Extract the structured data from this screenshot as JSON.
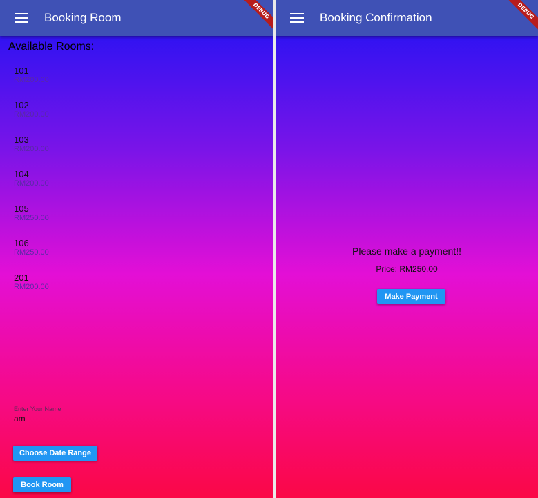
{
  "left": {
    "appbar": {
      "title": "Booking Room"
    },
    "debug_label": "DEBUG",
    "rooms_heading": "Available Rooms:",
    "rooms": [
      {
        "number": "101",
        "price": "RM200.00"
      },
      {
        "number": "102",
        "price": "RM200.00"
      },
      {
        "number": "103",
        "price": "RM200.00"
      },
      {
        "number": "104",
        "price": "RM200.00"
      },
      {
        "number": "105",
        "price": "RM250.00"
      },
      {
        "number": "106",
        "price": "RM250.00"
      },
      {
        "number": "201",
        "price": "RM200.00"
      }
    ],
    "name_field": {
      "label": "Enter Your Name",
      "value": "am"
    },
    "date_button": "Choose Date Range",
    "book_button": "Book Room"
  },
  "right": {
    "appbar": {
      "title": "Booking Confirmation"
    },
    "debug_label": "DEBUG",
    "message": "Please make a payment!!",
    "price": "Price: RM250.00",
    "pay_button": "Make Payment"
  },
  "colors": {
    "appbar": "#3f51b5",
    "button": "#2196f3",
    "gradient": [
      "#1a12f5",
      "#7a14e8",
      "#e30fd6",
      "#f50a8c",
      "#fb0846"
    ]
  },
  "icons": [
    "menu-icon"
  ]
}
